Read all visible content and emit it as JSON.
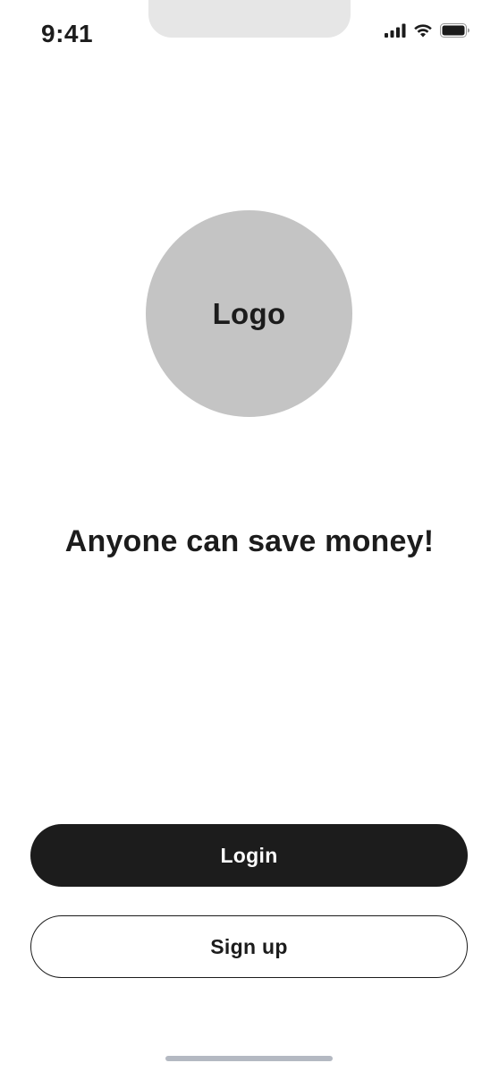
{
  "status_bar": {
    "time": "9:41",
    "icons": [
      "cellular-signal-icon",
      "wifi-icon",
      "battery-icon"
    ]
  },
  "logo": {
    "label": "Logo"
  },
  "tagline": "Anyone can save money!",
  "actions": {
    "login_label": "Login",
    "signup_label": "Sign up"
  },
  "colors": {
    "primary": "#1c1c1c",
    "logo_placeholder": "#c4c4c4",
    "notch": "#e6e6e6",
    "home_indicator": "#b4b9c2",
    "background": "#ffffff"
  }
}
